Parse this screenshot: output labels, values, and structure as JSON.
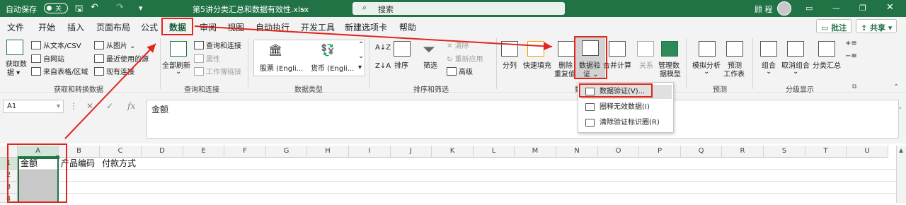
{
  "title_bar": {
    "autosave_label": "自动保存",
    "autosave_state": "关",
    "file_name": "第5讲分类汇总和数据有效性.xlsx",
    "search_placeholder": "搜索",
    "user_name": "顾 程"
  },
  "tabs": [
    {
      "label": "文件"
    },
    {
      "label": "开始"
    },
    {
      "label": "插入"
    },
    {
      "label": "页面布局"
    },
    {
      "label": "公式"
    },
    {
      "label": "数据",
      "active": true
    },
    {
      "label": "审阅"
    },
    {
      "label": "视图"
    },
    {
      "label": "自动执行"
    },
    {
      "label": "开发工具"
    },
    {
      "label": "新建选项卡"
    },
    {
      "label": "帮助"
    }
  ],
  "tab_buttons": {
    "comment": "批注",
    "share": "共享"
  },
  "ribbon": {
    "get_data": {
      "big": "获取数",
      "big2": "据",
      "from_text": "从文本/CSV",
      "from_web": "自网站",
      "from_table": "来自表格/区域",
      "from_picture": "从图片",
      "recent": "最近使用的源",
      "existing": "现有连接",
      "group": "获取和转换数据"
    },
    "queries": {
      "refresh_all": "全部刷新",
      "queries_conn": "查询和连接",
      "properties": "属性",
      "edit_links": "工作簿链接",
      "group": "查询和连接"
    },
    "data_types": {
      "stocks": "股票 (Engli...",
      "currency": "货币 (Engli...",
      "group": "数据类型"
    },
    "sort_filter": {
      "sort": "排序",
      "filter": "筛选",
      "clear": "清除",
      "reapply": "重新应用",
      "advanced": "高级",
      "group": "排序和筛选"
    },
    "tools": {
      "split": "分列",
      "flash_fill": "快速填充",
      "remove_dup": "删除",
      "remove_dup2": "重复值",
      "validation": "数据验",
      "validation2": "证",
      "consolidate": "合并计算",
      "relations": "关系",
      "manage_model": "管理数",
      "manage_model2": "据模型",
      "group": "数"
    },
    "forecast": {
      "whatif": "模拟分析",
      "forecast_sheet": "预测",
      "forecast_sheet2": "工作表",
      "group": "预测"
    },
    "outline": {
      "group_btn": "组合",
      "ungroup": "取消组合",
      "subtotal": "分类汇总",
      "group": "分级显示"
    }
  },
  "validation_menu": [
    {
      "label": "数据验证(V)..."
    },
    {
      "label": "圈释无效数据(I)"
    },
    {
      "label": "清除验证标识圈(R)"
    }
  ],
  "formula_bar": {
    "name_box": "A1",
    "fx": "fx",
    "content": "金额"
  },
  "columns": [
    "A",
    "B",
    "C",
    "D",
    "E",
    "F",
    "G",
    "H",
    "I",
    "J",
    "K",
    "L",
    "M",
    "N",
    "O",
    "P",
    "Q",
    "R",
    "S",
    "T",
    "U"
  ],
  "rows": [
    "1",
    "2",
    "3",
    "4"
  ],
  "cells": {
    "a1": "金额",
    "b1": "产品编码",
    "c1": "付款方式"
  },
  "colors": {
    "accent": "#217346",
    "annotation": "#e1261c"
  }
}
